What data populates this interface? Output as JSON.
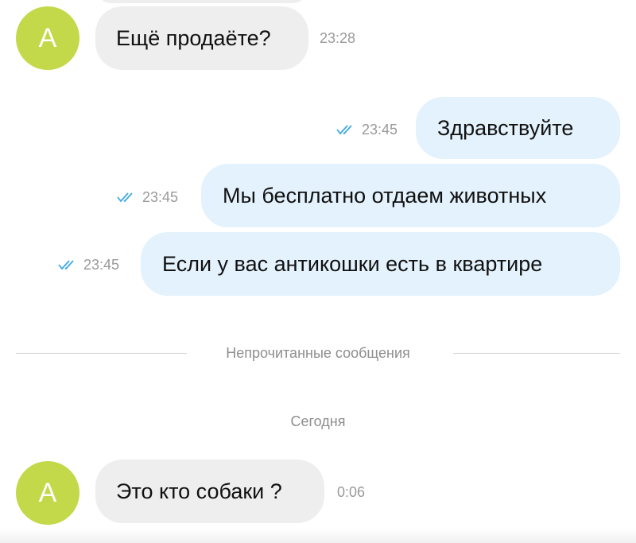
{
  "messages": [
    {
      "direction": "in",
      "avatar": "А",
      "text": "Ещё продаёте?",
      "time": "23:28"
    },
    {
      "direction": "out",
      "text": "Здравствуйте",
      "time": "23:45",
      "status": "read"
    },
    {
      "direction": "out",
      "text": "Мы бесплатно отдаем животных",
      "time": "23:45",
      "status": "read"
    },
    {
      "direction": "out",
      "text": "Если у вас антикошки есть в квартире",
      "time": "23:45",
      "status": "read"
    },
    {
      "direction": "in",
      "avatar": "А",
      "text": "Это кто собаки ?",
      "time": "0:06"
    }
  ],
  "unread_divider": "Непрочитанные сообщения",
  "date_label": "Сегодня",
  "colors": {
    "avatar": "#c4d94a",
    "incoming_bubble": "#eeeeee",
    "outgoing_bubble": "#e3f2fc",
    "read_check": "#3ea8e5",
    "timestamp": "#9a9a9a"
  },
  "icons": {
    "read_status": "double-check-icon"
  }
}
